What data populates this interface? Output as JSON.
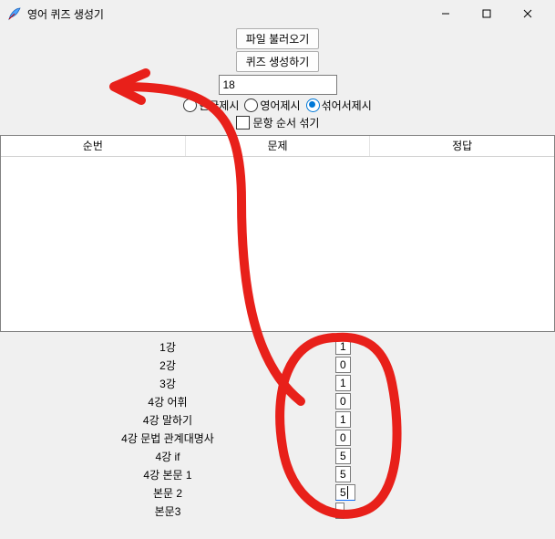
{
  "window": {
    "title": "영어 퀴즈 생성기"
  },
  "buttons": {
    "load_file": "파일 불러오기",
    "make_quiz": "퀴즈 생성하기"
  },
  "count_input": {
    "value": "18"
  },
  "radios": {
    "korean": "한글제시",
    "english": "영어제시",
    "mixed": "섞어서제시"
  },
  "checkbox": {
    "shuffle": "문항 순서 섞기"
  },
  "table_headers": {
    "no": "순번",
    "question": "문제",
    "answer": "정답"
  },
  "lessons": [
    {
      "label": "1강",
      "value": "1"
    },
    {
      "label": "2강",
      "value": "0"
    },
    {
      "label": "3강",
      "value": "1"
    },
    {
      "label": "4강 어휘",
      "value": "0"
    },
    {
      "label": "4강 말하기",
      "value": "1"
    },
    {
      "label": "4강 문법 관계대명사",
      "value": "0"
    },
    {
      "label": "4강 if",
      "value": "5"
    },
    {
      "label": "4강 본문 1",
      "value": "5"
    },
    {
      "label": "본문 2",
      "value": "5",
      "active": true
    },
    {
      "label": "본문3",
      "value": ""
    }
  ]
}
